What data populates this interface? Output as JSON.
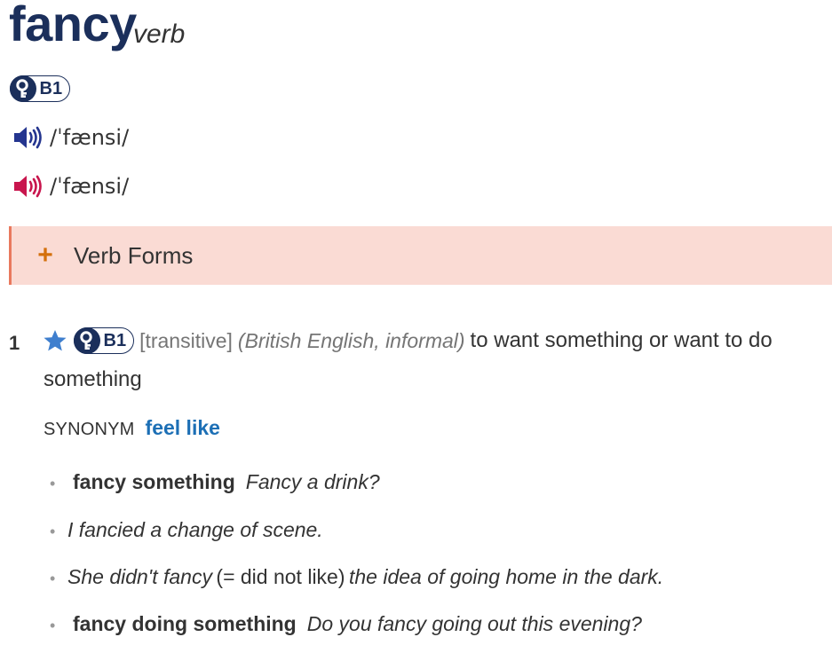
{
  "entry": {
    "headword": "fancy",
    "part_of_speech": "verb",
    "level": "B1"
  },
  "pronunciations": [
    {
      "variant": "British",
      "ipa": "/ˈfænsi/",
      "icon": "speaker-icon",
      "color": "#24358f"
    },
    {
      "variant": "American",
      "ipa": "/ˈfænsi/",
      "icon": "speaker-icon",
      "color": "#c8154d"
    }
  ],
  "verb_forms": {
    "toggle": "+",
    "label": "Verb Forms"
  },
  "sense": {
    "number": "1",
    "level": "B1",
    "grammar": "[transitive]",
    "labels": "(British English, informal)",
    "definition_part1": "to want something or want to do",
    "definition_part2": "something",
    "synonym_label": "SYNONYM",
    "synonym": "feel like",
    "examples": [
      {
        "bullet": "•",
        "collocation": "fancy something",
        "text": "Fancy a drink?"
      },
      {
        "bullet": "•",
        "text": "I fancied a change of scene."
      },
      {
        "bullet": "•",
        "text_before": "She didn't fancy",
        "gloss": "(= did not like)",
        "text_after": "the idea of going home in the dark."
      },
      {
        "bullet": "•",
        "collocation": "fancy doing something",
        "text": "Do you fancy going out this evening?"
      }
    ]
  },
  "colors": {
    "headword": "#1b2f5b",
    "verb_forms_bg": "#fadbd4",
    "verb_forms_border": "#e9795e",
    "plus": "#d4700c",
    "synonym_link": "#1c6fb5",
    "star": "#3f7fce"
  }
}
